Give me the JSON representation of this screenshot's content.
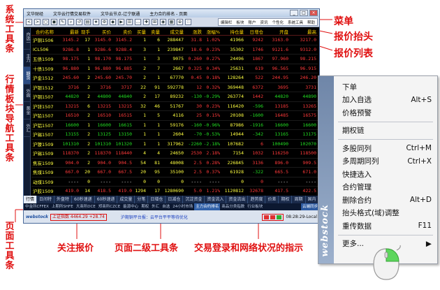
{
  "window": {
    "title": "文华财经",
    "title2": "文华云行情交易软件",
    "title3": "主力合约排名 - 页面",
    "user": "文华云节点-辽宁联通"
  },
  "toolbar": {
    "icons": [
      "<",
      ">",
      "◻",
      "◼",
      "✎",
      "⌕",
      "↺",
      "▤",
      "★",
      "⚙",
      "◆",
      "▶",
      "☰",
      "…",
      "✚",
      "⊞",
      "◉",
      "▦",
      "⊕",
      "∷"
    ],
    "menu": [
      "编辑栏",
      "板块",
      "账户",
      "资讯",
      "个性化",
      "系统工具",
      "帮助"
    ]
  },
  "left_tabs": [
    "自选一",
    "主力",
    "期货",
    "外盘",
    "黄金",
    "外汇"
  ],
  "table": {
    "headers": [
      "合约名称",
      "最新",
      "现手",
      "买价",
      "卖价",
      "买量",
      "卖量",
      "成交量",
      "涨跌",
      "涨幅%",
      "持仓量",
      "日增仓",
      "开盘",
      "最高"
    ],
    "rows": [
      [
        "沪铜1506",
        "3145.2",
        "17",
        "3145.0",
        "3145.2",
        "1",
        "6",
        "288447",
        "31.8",
        "1.02%",
        "41966",
        "9242",
        "3163.0",
        "3217.0"
      ],
      [
        "ICL506",
        "9286.8",
        "1",
        "9286.6",
        "9288.4",
        "3",
        "1",
        "239847",
        "18.6",
        "0.23%",
        "35302",
        "1746",
        "9121.6",
        "9312.0"
      ],
      [
        "五债1509",
        "98.175",
        "1",
        "98.170",
        "98.175",
        "1",
        "3",
        "9075",
        "0.260",
        "0.27%",
        "24496",
        "1867",
        "97.960",
        "98.215"
      ],
      [
        "十债1509",
        "96.880",
        "1",
        "96.880",
        "96.885",
        "2",
        "7",
        "2667",
        "0.325",
        "0.34%",
        "25631",
        "619",
        "96.565",
        "96.915"
      ],
      [
        "沪金1512",
        "245.60",
        "2",
        "245.60",
        "245.70",
        "2",
        "1",
        "67770",
        "0.45",
        "0.18%",
        "128264",
        "522",
        "244.95",
        "246.20"
      ],
      [
        "沪银1512",
        "3716",
        "2",
        "3716",
        "3717",
        "22",
        "91",
        "592778",
        "12",
        "0.32%",
        "369448",
        "6372",
        "3695",
        "3731"
      ],
      [
        "沪铜1507",
        "44820",
        "2",
        "44800",
        "44840",
        "2",
        "17",
        "89232",
        "-130",
        "-0.29%",
        "263774",
        "1442",
        "44820",
        "44890"
      ],
      [
        "沪锌1507",
        "13215",
        "6",
        "13215",
        "13215",
        "32",
        "46",
        "51767",
        "30",
        "0.23%",
        "116420",
        "-596",
        "13185",
        "13265"
      ],
      [
        "沪铅1507",
        "16510",
        "2",
        "16510",
        "16515",
        "1",
        "5",
        "4116",
        "25",
        "0.15%",
        "20108",
        "-1600",
        "16485",
        "16575"
      ],
      [
        "沪铝1507",
        "16600",
        "1",
        "16600",
        "16615",
        "1",
        "1",
        "59176",
        "-160",
        "-0.96%",
        "87986",
        "-1916",
        "16600",
        "16600"
      ],
      [
        "沪锡1507",
        "13155",
        "2",
        "13125",
        "13150",
        "1",
        "1",
        "2604",
        "-70",
        "-0.53%",
        "14944",
        "-342",
        "13165",
        "13175"
      ],
      [
        "沪镍1509",
        "101310",
        "2",
        "101310",
        "101320",
        "1",
        "1",
        "317962",
        "-2260",
        "-2.18%",
        "107682",
        "6",
        "100490",
        "102070"
      ],
      [
        "沪锡1509",
        "118370",
        "2",
        "118370",
        "118440",
        "4",
        "4",
        "24650",
        "2530",
        "2.18%",
        "7154",
        "1032",
        "116250",
        "118500"
      ],
      [
        "焦炭1509",
        "904.0",
        "2",
        "904.0",
        "904.5",
        "54",
        "81",
        "48008",
        "2.5",
        "0.28%",
        "226845",
        "3136",
        "896.0",
        "909.5"
      ],
      [
        "焦煤1509",
        "667.0",
        "20",
        "667.0",
        "667.5",
        "20",
        "95",
        "35100",
        "2.5",
        "0.37%",
        "61928",
        "-322",
        "665.5",
        "671.0"
      ],
      [
        "动煤1509",
        "----",
        "0",
        "----",
        "----",
        "0",
        "0",
        "0",
        "----",
        "----",
        "0",
        "0",
        "----",
        "----"
      ],
      [
        "沪胶1509",
        "419.0",
        "14",
        "418.5",
        "419.0",
        "1294",
        "17",
        "1280690",
        "5.0",
        "1.21%",
        "1120812",
        "32678",
        "417.5",
        "422.5"
      ],
      [
        "螺纹1510",
        "2322",
        "2",
        "2321",
        "2322",
        "3259",
        "20",
        "1002230",
        "2",
        "0.09%",
        "2839710",
        "13948",
        "2321",
        "2324"
      ],
      [
        "热卷1510",
        "2422",
        "4",
        "2420",
        "2421",
        "2",
        "1",
        "4160",
        "-10",
        "-0.41%",
        "29600",
        "200",
        "2424",
        "2429"
      ],
      [
        "硅铁1509",
        "----",
        "0",
        "----",
        "----",
        "0",
        "0",
        "0",
        "----",
        "----",
        "32",
        "0",
        "----",
        "----"
      ],
      [
        "锰硅1509",
        "----",
        "0",
        "----",
        "----",
        "0",
        "0",
        "0",
        "----",
        "----",
        "0",
        "0",
        "----",
        "----"
      ]
    ]
  },
  "tabs": [
    "行情",
    "日间特",
    "外盘特",
    "60秒速递",
    "60秒速递",
    "成交量",
    "分笔",
    "日增仓",
    "日减仓",
    "沉淀资金",
    "资金流入",
    "资金流出",
    "趋势度",
    "价差",
    "期权",
    "周期"
  ],
  "tabs2": [
    "国内",
    "股指",
    "外盘",
    "商品",
    "金属",
    "农产",
    "能化",
    "期权",
    "日资"
  ],
  "exchange_bar": {
    "items": [
      "中金所CFFEX",
      "上期所SHFE",
      "大商所DCE",
      "郑商所CZCE",
      "能源中心",
      "期权",
      "外汇",
      "自选",
      "24小时市场",
      "主力合约排名",
      "商品分类指数",
      "行业板块"
    ],
    "right": "云端同步"
  },
  "status": {
    "logo": "webstock",
    "quote": "上证指数 4464.29 +28.74",
    "ticker": "沪期铜平台报：云平台平平等待优化",
    "time": "08:28:29-Local"
  },
  "context_menu": {
    "brand": "webstock",
    "groups": [
      [
        {
          "label": "下单",
          "key": ""
        },
        {
          "label": "加入自选",
          "key": "Alt+S"
        },
        {
          "label": "价格预警",
          "key": ""
        }
      ],
      [
        {
          "label": "期权链",
          "key": ""
        }
      ],
      [
        {
          "label": "多股同列",
          "key": "Ctrl+M"
        },
        {
          "label": "多周期同列",
          "key": "Ctrl+X"
        },
        {
          "label": "快捷选入",
          "key": ""
        },
        {
          "label": "合约管理",
          "key": ""
        },
        {
          "label": "删除合约",
          "key": "Alt+D"
        },
        {
          "label": "抬头格式(域)调整",
          "key": ""
        },
        {
          "label": "重传数据",
          "key": "F11"
        }
      ],
      [
        {
          "label": "更多...",
          "key": "▶"
        }
      ]
    ]
  },
  "annotations": {
    "system_toolbar": "系统工具条",
    "market_nav": "行情板块导航工具条",
    "page_toolbar": "页面工具条",
    "menu": "菜单",
    "quote_header": "报价抬头",
    "quote_list": "报价列表",
    "watch_quote": "关注报价",
    "page_secondary": "页面二级工具条",
    "trade_status": "交易登录和网络状况的指示"
  }
}
